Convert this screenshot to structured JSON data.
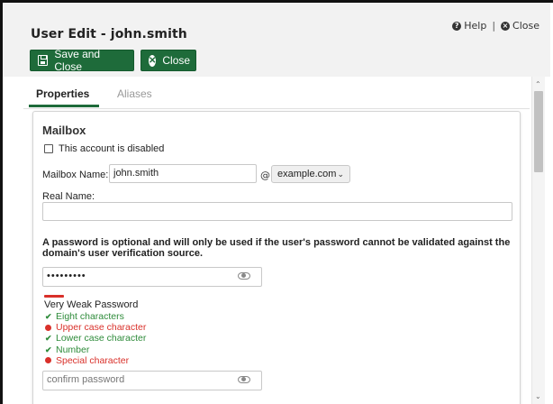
{
  "dialog": {
    "title": "User Edit - john.smith",
    "help_label": "Help",
    "close_link_label": "Close",
    "separator": "|"
  },
  "toolbar": {
    "save_close_label": "Save and Close",
    "close_label": "Close"
  },
  "tabs": [
    {
      "label": "Properties",
      "active": true
    },
    {
      "label": "Aliases",
      "active": false
    }
  ],
  "mailbox": {
    "section_title": "Mailbox",
    "disabled_checkbox_label": "This account is disabled",
    "disabled_checked": false,
    "mailbox_name_label": "Mailbox Name:",
    "mailbox_name_value": "john.smith",
    "at_symbol": "@",
    "domain_value": "example.com",
    "real_name_label": "Real Name:",
    "real_name_value": ""
  },
  "password": {
    "notice": "A password is optional and will only be used if the user's password cannot be validated against the domain's user verification source.",
    "masked_value": "•••••••••",
    "strength_label": "Very Weak Password",
    "rules": [
      {
        "text": "Eight characters",
        "ok": true
      },
      {
        "text": "Upper case character",
        "ok": false
      },
      {
        "text": "Lower case character",
        "ok": true
      },
      {
        "text": "Number",
        "ok": true
      },
      {
        "text": "Special character",
        "ok": false
      }
    ],
    "confirm_placeholder": "confirm password"
  },
  "colors": {
    "primary_green": "#1e6b3a",
    "error_red": "#d9302a",
    "success_green": "#2e8b3a"
  }
}
